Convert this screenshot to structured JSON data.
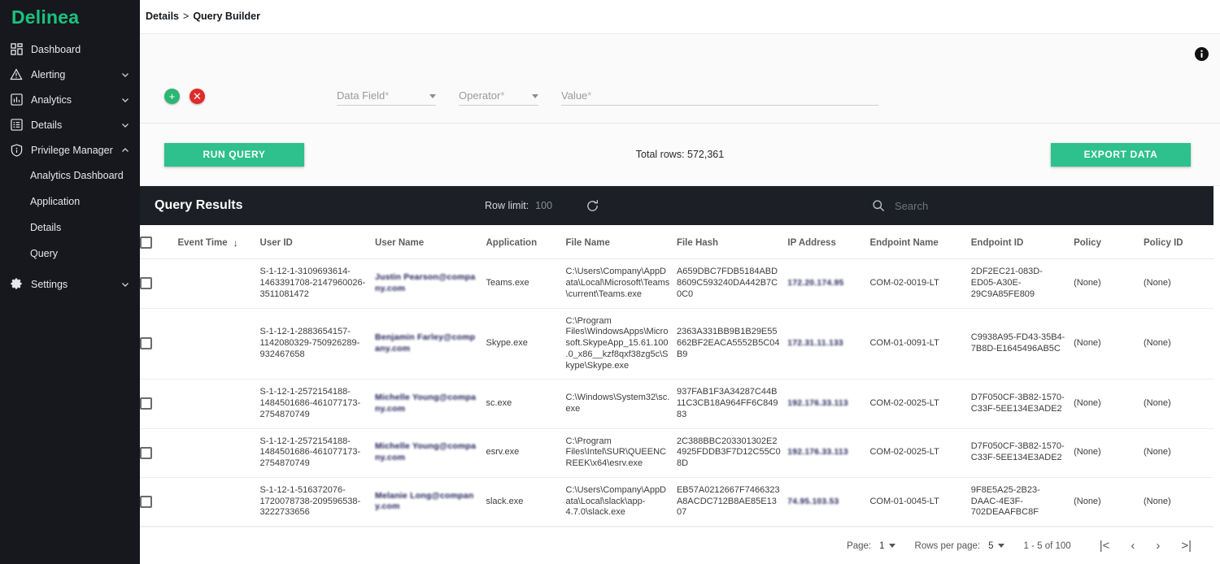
{
  "brand": {
    "name": "Delinea",
    "color": "#19c37d"
  },
  "sidebar": {
    "items": [
      {
        "label": "Dashboard",
        "icon": "dashboard-icon",
        "expandable": false
      },
      {
        "label": "Alerting",
        "icon": "alert-triangle-icon",
        "expandable": true
      },
      {
        "label": "Analytics",
        "icon": "bar-chart-icon",
        "expandable": true
      },
      {
        "label": "Details",
        "icon": "list-icon",
        "expandable": true
      },
      {
        "label": "Privilege Manager",
        "icon": "shield-info-icon",
        "expandable": true,
        "expanded": true
      },
      {
        "label": "Settings",
        "icon": "gear-icon",
        "expandable": true
      }
    ],
    "sub_items": [
      {
        "label": "Analytics Dashboard"
      },
      {
        "label": "Application"
      },
      {
        "label": "Details"
      },
      {
        "label": "Query"
      }
    ]
  },
  "breadcrumb": {
    "parent": "Details",
    "separator": ">",
    "current": "Query Builder"
  },
  "query_builder": {
    "add_label": "+",
    "remove_label": "✕",
    "data_field": {
      "label": "Data Field",
      "required_mark": "*",
      "value": ""
    },
    "operator": {
      "label": "Operator",
      "required_mark": "*",
      "value": ""
    },
    "value": {
      "label": "Value",
      "required_mark": "*",
      "value": ""
    },
    "info_icon": "info-icon"
  },
  "actions": {
    "run_query": "RUN QUERY",
    "export_data": "EXPORT DATA",
    "total_rows": "Total rows: 572,361",
    "accent_color": "#2ec08d"
  },
  "results": {
    "title": "Query Results",
    "row_limit_label": "Row limit:",
    "row_limit_value": "100",
    "refresh_icon": "refresh-icon",
    "search_icon": "search-icon",
    "search_placeholder": "Search",
    "header_bg": "#1c1f26"
  },
  "table": {
    "columns": [
      "Event Time",
      "User ID",
      "User Name",
      "Application",
      "File Name",
      "File Hash",
      "IP Address",
      "Endpoint Name",
      "Endpoint ID",
      "Policy",
      "Policy ID"
    ],
    "sort_column": "Event Time",
    "sort_direction": "desc",
    "sort_arrow": "↓",
    "rows": [
      {
        "event_time": "",
        "user_id": "S-1-12-1-3109693614-1463391708-2147960026-3511081472",
        "user_name": "Justin Pearson@company.com",
        "user_name_redacted": true,
        "application": "Teams.exe",
        "file_name": "C:\\Users\\Company\\AppData\\Local\\Microsoft\\Teams\\current\\Teams.exe",
        "file_hash": "A659DBC7FDB5184ABD8609C593240DA442B7C0C0",
        "ip_address": "172.20.174.95",
        "ip_redacted": true,
        "endpoint_name": "COM-02-0019-LT",
        "endpoint_id": "2DF2EC21-083D-ED05-A30E-29C9A85FE809",
        "policy": "(None)",
        "policy_id": "(None)"
      },
      {
        "event_time": "",
        "user_id": "S-1-12-1-2883654157-1142080329-750926289-932467658",
        "user_name": "Benjamin Farley@company.com",
        "user_name_redacted": true,
        "application": "Skype.exe",
        "file_name": "C:\\Program Files\\WindowsApps\\Microsoft.SkypeApp_15.61.100.0_x86__kzf8qxf38zg5c\\Skype\\Skype.exe",
        "file_hash": "2363A331BB9B1B29E55662BF2EACA5552B5C04B9",
        "ip_address": "172.31.11.133",
        "ip_redacted": true,
        "endpoint_name": "COM-01-0091-LT",
        "endpoint_id": "C9938A95-FD43-35B4-7B8D-E1645496AB5C",
        "policy": "(None)",
        "policy_id": "(None)"
      },
      {
        "event_time": "",
        "user_id": "S-1-12-1-2572154188-1484501686-461077173-2754870749",
        "user_name": "Michelle Young@company.com",
        "user_name_redacted": true,
        "application": "sc.exe",
        "file_name": "C:\\Windows\\System32\\sc.exe",
        "file_hash": "937FAB1F3A34287C44B11C3CB18A964FF6C84983",
        "ip_address": "192.176.33.113",
        "ip_redacted": true,
        "endpoint_name": "COM-02-0025-LT",
        "endpoint_id": "D7F050CF-3B82-1570-C33F-5EE134E3ADE2",
        "policy": "(None)",
        "policy_id": "(None)"
      },
      {
        "event_time": "",
        "user_id": "S-1-12-1-2572154188-1484501686-461077173-2754870749",
        "user_name": "Michelle Young@company.com",
        "user_name_redacted": true,
        "application": "esrv.exe",
        "file_name": "C:\\Program Files\\Intel\\SUR\\QUEENCREEK\\x64\\esrv.exe",
        "file_hash": "2C388BBC203301302E24925FDDB3F7D12C55C08D",
        "ip_address": "192.176.33.113",
        "ip_redacted": true,
        "endpoint_name": "COM-02-0025-LT",
        "endpoint_id": "D7F050CF-3B82-1570-C33F-5EE134E3ADE2",
        "policy": "(None)",
        "policy_id": "(None)"
      },
      {
        "event_time": "",
        "user_id": "S-1-12-1-516372076-1720078738-209596538-3222733656",
        "user_name": "Melanie Long@company.com",
        "user_name_redacted": true,
        "application": "slack.exe",
        "file_name": "C:\\Users\\Company\\AppData\\Local\\slack\\app-4.7.0\\slack.exe",
        "file_hash": "EB57A0212667F7466323A8ACDC712B8AE85E1307",
        "ip_address": "74.95.103.53",
        "ip_redacted": true,
        "endpoint_name": "COM-01-0045-LT",
        "endpoint_id": "9F8E5A25-2B23-DAAC-4E3F-702DEAAFBC8F",
        "policy": "(None)",
        "policy_id": "(None)"
      }
    ]
  },
  "pagination": {
    "page_label": "Page:",
    "page_value": "1",
    "rows_per_page_label": "Rows per page:",
    "rows_per_page_value": "5",
    "range": "1 - 5 of 100",
    "first_icon": "|<",
    "prev_icon": "‹",
    "next_icon": "›",
    "last_icon": ">|"
  }
}
